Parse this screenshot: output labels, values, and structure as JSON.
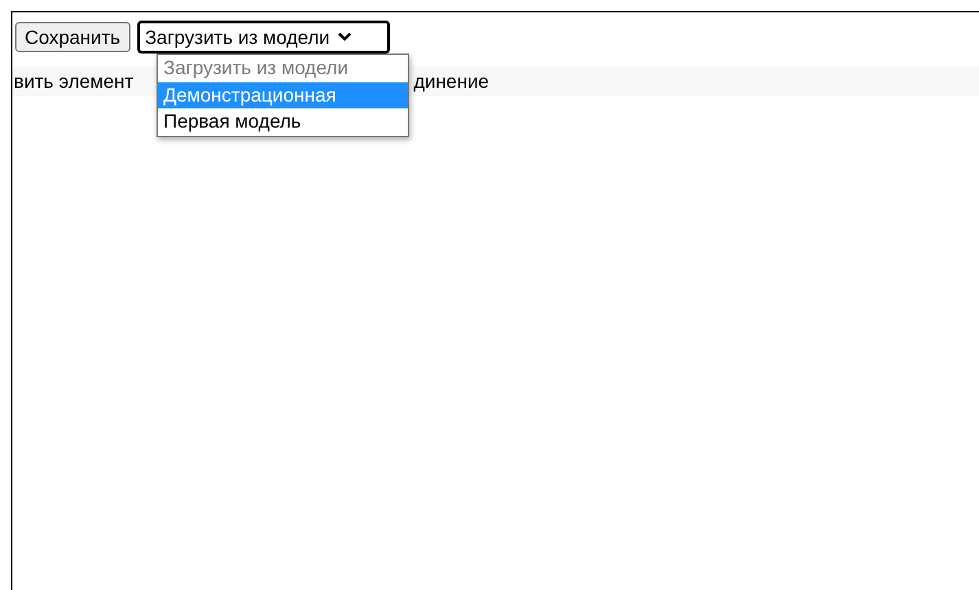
{
  "toolbar": {
    "save_button": "Сохранить",
    "model_select": {
      "value": "Загрузить из модели",
      "expanded": true,
      "options": [
        {
          "label": "Загрузить из модели",
          "disabled": true,
          "highlighted": false
        },
        {
          "label": "Демонстрационная",
          "disabled": false,
          "highlighted": true
        },
        {
          "label": "Первая модель",
          "disabled": false,
          "highlighted": false
        }
      ]
    }
  },
  "menu_bar": {
    "items": [
      "вить элемент",
      "динение"
    ]
  }
}
